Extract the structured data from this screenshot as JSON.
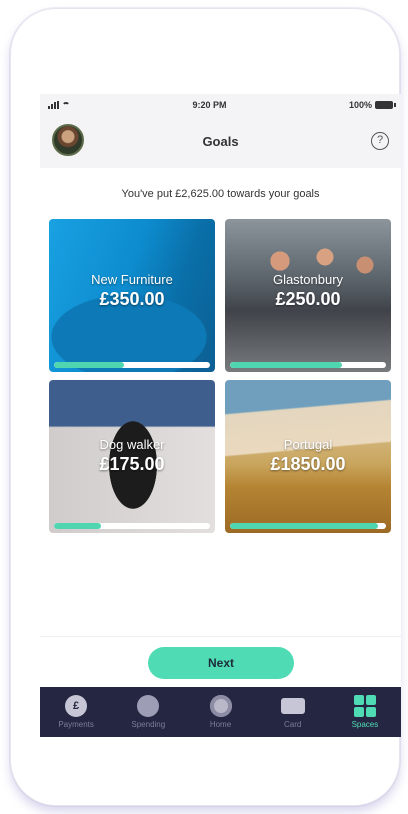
{
  "status": {
    "time": "9:20 PM",
    "battery": "100%"
  },
  "header": {
    "title": "Goals",
    "help": "?"
  },
  "summary": "You've put £2,625.00 towards your goals",
  "goals": [
    {
      "name": "New Furniture",
      "amount": "£350.00",
      "progress": 0.45
    },
    {
      "name": "Glastonbury",
      "amount": "£250.00",
      "progress": 0.72
    },
    {
      "name": "Dog walker",
      "amount": "£175.00",
      "progress": 0.3
    },
    {
      "name": "Portugal",
      "amount": "£1850.00",
      "progress": 0.95
    }
  ],
  "next_label": "Next",
  "tabs": [
    {
      "label": "Payments",
      "icon": "pound-icon",
      "glyph": "£"
    },
    {
      "label": "Spending",
      "icon": "spending-icon",
      "glyph": ""
    },
    {
      "label": "Home",
      "icon": "home-icon",
      "glyph": ""
    },
    {
      "label": "Card",
      "icon": "card-icon",
      "glyph": ""
    },
    {
      "label": "Spaces",
      "icon": "spaces-icon",
      "glyph": ""
    }
  ],
  "colors": {
    "accent": "#4fdcb4",
    "tabbar": "#252742"
  }
}
